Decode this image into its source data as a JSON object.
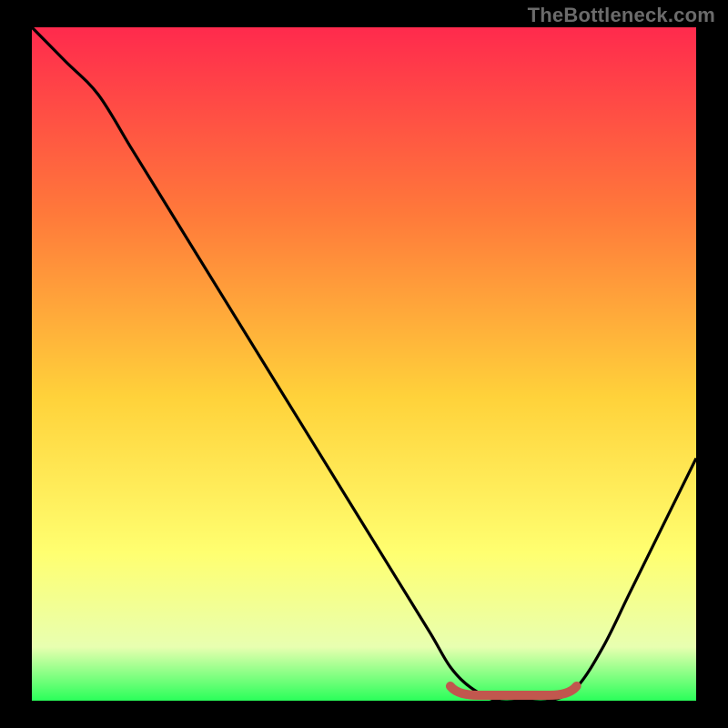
{
  "watermark": "TheBottleneck.com",
  "colors": {
    "background": "#000000",
    "gradient_top": "#ff2a4d",
    "gradient_mid_upper": "#ff7a3a",
    "gradient_mid": "#ffd23a",
    "gradient_mid_lower": "#ffff70",
    "gradient_lower": "#e8ffb0",
    "gradient_bottom": "#2aff5a",
    "curve": "#000000",
    "marker": "#c1574e"
  },
  "chart_data": {
    "type": "line",
    "title": "",
    "xlabel": "",
    "ylabel": "",
    "x_range": [
      0,
      100
    ],
    "y_range": [
      0,
      100
    ],
    "series": [
      {
        "name": "bottleneck-curve",
        "x": [
          0,
          5,
          10,
          15,
          20,
          25,
          30,
          35,
          40,
          45,
          50,
          55,
          60,
          63,
          66,
          70,
          74,
          78,
          82,
          86,
          90,
          95,
          100
        ],
        "y": [
          100,
          95,
          90,
          82,
          74,
          66,
          58,
          50,
          42,
          34,
          26,
          18,
          10,
          5,
          2,
          0,
          0,
          0,
          2,
          8,
          16,
          26,
          36
        ]
      }
    ],
    "optimal_band": {
      "name": "optimal-range-marker",
      "x_start": 63,
      "x_end": 82,
      "y": 0
    },
    "annotations": []
  }
}
